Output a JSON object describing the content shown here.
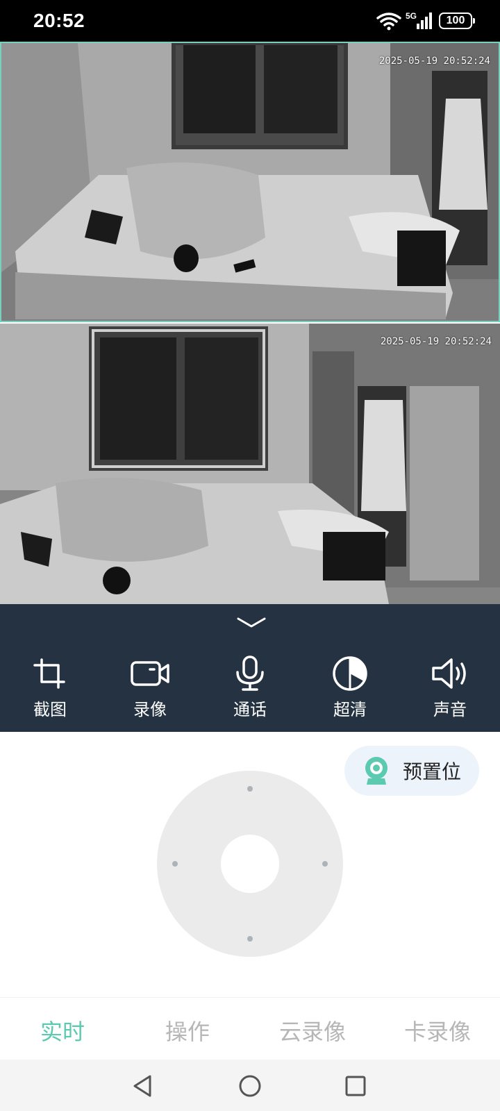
{
  "status_bar": {
    "time": "20:52",
    "network": "5G",
    "battery": "100"
  },
  "feeds": [
    {
      "timestamp": "2025-05-19 20:52:24"
    },
    {
      "timestamp": "2025-05-19 20:52:24"
    }
  ],
  "controls": [
    {
      "icon": "crop-icon",
      "label": "截图"
    },
    {
      "icon": "video-camera-icon",
      "label": "录像"
    },
    {
      "icon": "microphone-icon",
      "label": "通话"
    },
    {
      "icon": "contrast-icon",
      "label": "超清"
    },
    {
      "icon": "speaker-icon",
      "label": "声音"
    }
  ],
  "preset": {
    "icon": "camera-icon",
    "label": "预置位"
  },
  "tabs": [
    {
      "label": "实时",
      "active": true
    },
    {
      "label": "操作",
      "active": false
    },
    {
      "label": "云录像",
      "active": false
    },
    {
      "label": "卡录像",
      "active": false
    }
  ],
  "colors": {
    "accent": "#5cc9b1",
    "control_bar": "#253241",
    "inactive_tab": "#b6b6b6"
  }
}
